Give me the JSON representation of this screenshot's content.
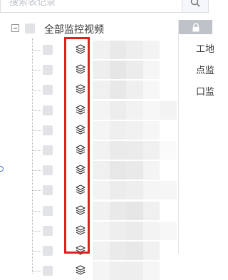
{
  "search": {
    "placeholder": "搜索表记录",
    "icon": "search-icon"
  },
  "tree": {
    "root": {
      "label": "全部监控视频",
      "expanded": true
    },
    "child_icon": "layers-icon",
    "children": [
      {
        "shade": [
          "#f1f1f1",
          "#e9e9e9",
          "#eeeeee",
          "#f3f3f3",
          "#ffffff"
        ]
      },
      {
        "shade": [
          "#eeeeee",
          "#e6e6e6",
          "#ececec",
          "#f6f6f6",
          "#ffffff"
        ]
      },
      {
        "shade": [
          "#f0f0f0",
          "#e8e8e8",
          "#efefef",
          "#f7f7f7",
          "#ffffff"
        ]
      },
      {
        "shade": [
          "#f4f4f4",
          "#ededed",
          "#f2f2f2",
          "#f7f7f7",
          "#f3f3f3"
        ]
      },
      {
        "shade": [
          "#f5f5f5",
          "#efefef",
          "#f1f1f1",
          "#f6f6f6",
          "#ffffff"
        ]
      },
      {
        "shade": [
          "#f2f2f2",
          "#eaeaea",
          "#ebebeb",
          "#f0f0f0",
          "#fafafa"
        ]
      },
      {
        "shade": [
          "#f0f0f0",
          "#e7e7e7",
          "#e9e9e9",
          "#f4f4f4",
          "#ffffff"
        ]
      },
      {
        "shade": [
          "#f3f3f3",
          "#ececec",
          "#eeeeee",
          "#f5f5f5",
          "#f6f6f6"
        ]
      },
      {
        "shade": [
          "#f1f1f1",
          "#e9e9e9",
          "#e6e6e6",
          "#f0f0f0",
          "#ffffff"
        ]
      },
      {
        "shade": [
          "#f4f4f4",
          "#eeeeee",
          "#ebebeb",
          "#f3f3f3",
          "#f7f7f7"
        ]
      },
      {
        "shade": [
          "#f2f2f2",
          "#eaeaea",
          "#e8e8e8",
          "#f1f1f1",
          "#ffffff"
        ]
      },
      {
        "shade": [
          "#f5f5f5",
          "#efefef",
          "#eeeeee",
          "#f6f6f6",
          "#ffffff"
        ]
      }
    ]
  },
  "right_panel": {
    "lock_icon": "lock-icon",
    "items": [
      "工地",
      "点监",
      "口监"
    ]
  },
  "colors": {
    "highlight_border": "#e02020"
  }
}
